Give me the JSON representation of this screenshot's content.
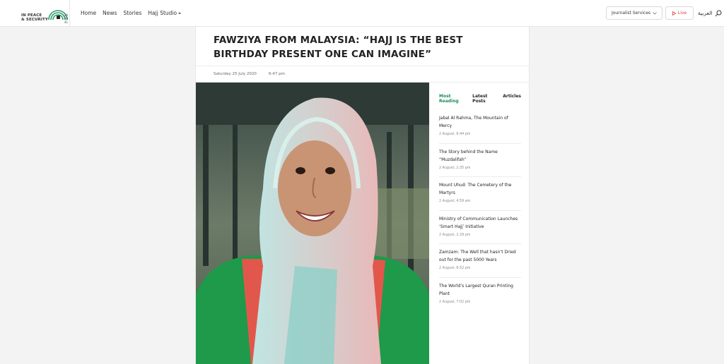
{
  "header": {
    "logo_text": "IN PEACE\n& SECURITY",
    "logo_year": "20 20 41",
    "nav": [
      "Home",
      "News",
      "Stories",
      "Hajj Studio"
    ],
    "journalist_services": "Journalist Services",
    "live": "Live",
    "language": "العربية"
  },
  "article": {
    "title": "FAWZIYA FROM MALAYSIA: “HAJJ IS THE BEST BIRTHDAY PRESENT ONE CAN IMAGINE”",
    "date": "Saturday 25 July 2020",
    "time": "6:47 pm"
  },
  "sidebar": {
    "tabs": [
      "Most Reading",
      "Latest Posts",
      "Articles"
    ],
    "items": [
      {
        "title": "Jabal Al Rahma, The Mountain of Mercy",
        "date": "2 August, 6:44 pm"
      },
      {
        "title": "The Story behind the Name “Muzdalifah”",
        "date": "2 August, 2:35 pm"
      },
      {
        "title": "Mount Uhud: The Cemetery of the Martyrs",
        "date": "2 August, 4:59 am"
      },
      {
        "title": "Ministry of Communication Launches ‘Smart Hajj’ Initiative",
        "date": "2 August, 2:29 pm"
      },
      {
        "title": "Zamzam: The Well that hasn’t Dried out for the past 5000 Years",
        "date": "2 August, 6:52 pm"
      },
      {
        "title": "The World’s Largest Quran Printing Plant",
        "date": "2 August, 7:02 pm"
      }
    ]
  },
  "colors": {
    "accent": "#1e8a5a",
    "live": "#e53935"
  }
}
